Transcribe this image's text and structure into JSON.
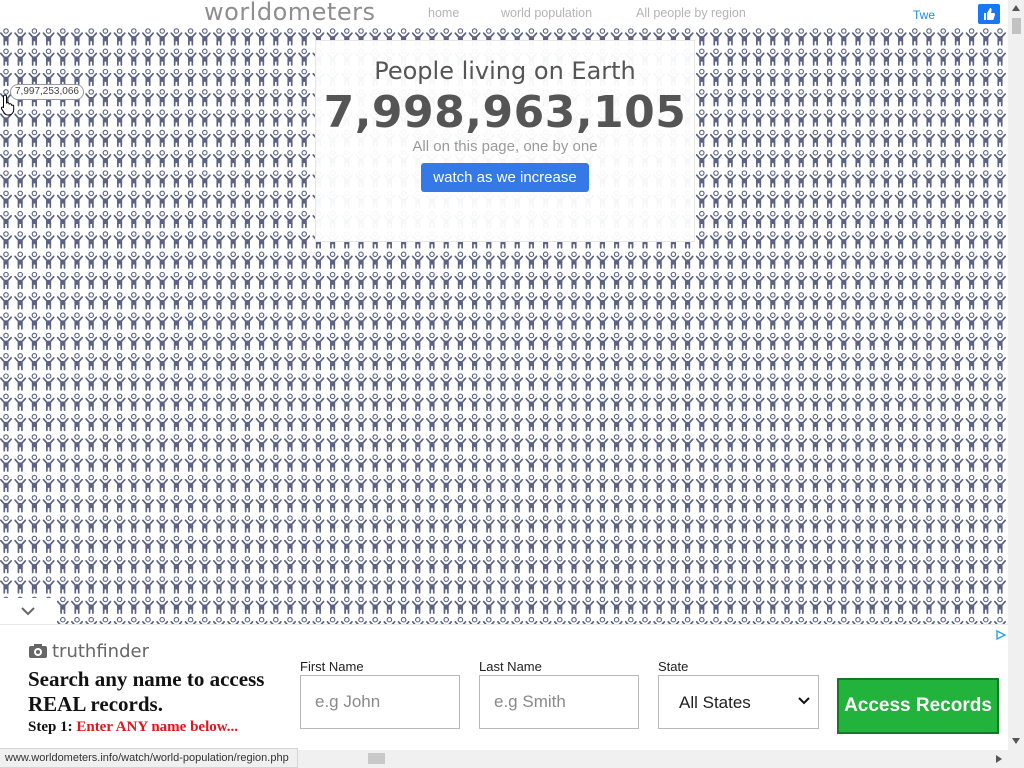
{
  "header": {
    "logo_text": "worldometers",
    "nav": [
      {
        "label": "home"
      },
      {
        "label": "world population"
      },
      {
        "label": "All people by region"
      }
    ],
    "tweet_label": "Twe"
  },
  "hero": {
    "title": "People living on Earth",
    "count": "7,998,963,105",
    "subtitle": "All on this page, one by one",
    "button_label": "watch as we increase"
  },
  "tooltip": {
    "value": "7,997,253,066"
  },
  "people_grid": {
    "icon": "person-icon",
    "color": "#5b6284"
  },
  "ad": {
    "brand": "truthfinder",
    "headline": "Search any name to access REAL records.",
    "step_label": "Step 1:",
    "step_text": "Enter ANY name below...",
    "fields": {
      "first_name": {
        "label": "First Name",
        "placeholder": "e.g John"
      },
      "last_name": {
        "label": "Last Name",
        "placeholder": "e.g Smith"
      },
      "state": {
        "label": "State",
        "value": "All States"
      }
    },
    "button_label": "Access Records",
    "button_color": "#21b33c"
  },
  "status_bar": {
    "url": "www.worldometers.info/watch/world-population/region.php"
  }
}
